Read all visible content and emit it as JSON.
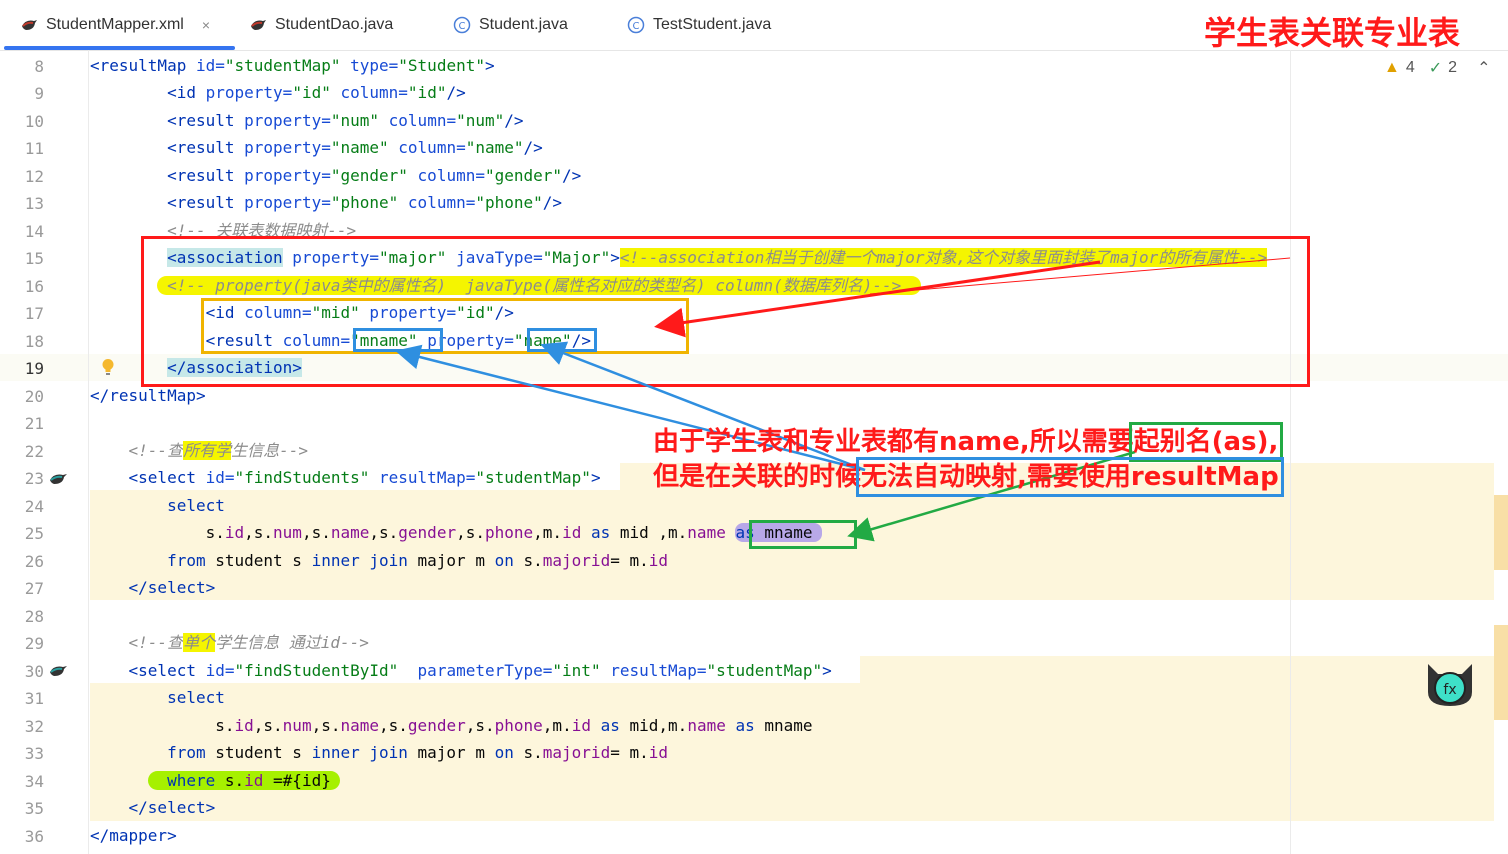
{
  "tabs": [
    {
      "label": "StudentMapper.xml",
      "icon": "mybatis-bird-icon",
      "active": true
    },
    {
      "label": "StudentDao.java",
      "icon": "mybatis-bird-icon",
      "active": false
    },
    {
      "label": "Student.java",
      "icon": "class-c-icon",
      "active": false
    },
    {
      "label": "TestStudent.java",
      "icon": "class-c-icon",
      "active": false
    }
  ],
  "tab_close": "×",
  "page_title": "学生表关联专业表",
  "inspections": {
    "warnings": "4",
    "checks": "2"
  },
  "line_numbers": [
    "8",
    "9",
    "10",
    "11",
    "12",
    "13",
    "14",
    "15",
    "16",
    "17",
    "18",
    "19",
    "20",
    "21",
    "22",
    "23",
    "24",
    "25",
    "26",
    "27",
    "28",
    "29",
    "30",
    "31",
    "32",
    "33",
    "34",
    "35",
    "36"
  ],
  "annotation": {
    "line1_a": "由于学生表和专业表都有name,所以需要",
    "line1_b": "起别名(as),",
    "line2_a": "但是在关联的时候",
    "line2_b": "无法自动映射,需要使用resultMap"
  },
  "colors": {
    "red_box": "#ff1a1a",
    "yellow_box": "#f0b400",
    "blue_box": "#2f8fe0",
    "green_box": "#22aa44",
    "highlight_yellow": "#f5f500",
    "current_line": "#fbfbf4"
  }
}
